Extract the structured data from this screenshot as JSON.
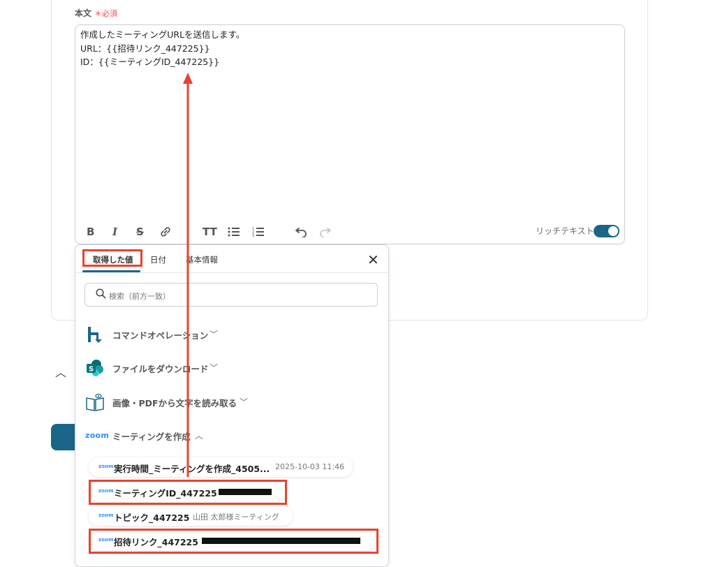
{
  "field": {
    "label": "本文",
    "required_mark": "＊必須"
  },
  "editor": {
    "lines": [
      "作成したミーティングURLを送信します。",
      "URL：{{招待リンク_447225}}",
      "ID：{{ミーティングID_447225}}"
    ]
  },
  "toolbar": {
    "rich_text_label": "リッチテキスト",
    "rich_text_enabled": true
  },
  "popup": {
    "tabs": [
      "取得した値",
      "日付",
      "基本情報"
    ],
    "active_tab": "取得した値",
    "search_placeholder": "検索（前方一致）",
    "sections": [
      {
        "label": "コマンドオペレーション",
        "icon": "command-operation-icon",
        "expanded": false
      },
      {
        "label": "ファイルをダウンロード",
        "icon": "sharepoint-icon",
        "expanded": false
      },
      {
        "label": "画像・PDFから文字を読み取る",
        "icon": "ocr-book-icon",
        "expanded": false
      },
      {
        "label": "ミーティングを作成",
        "icon": "zoom-logo",
        "expanded": true
      }
    ],
    "items": [
      {
        "title": "実行時間_ミーティングを作成_4505...",
        "value": "2025-10-03 11:46"
      },
      {
        "title": "ミーティングID_447225",
        "value": ""
      },
      {
        "title": "トピック_447225",
        "value": "山田 太郎様ミーティング"
      },
      {
        "title": "招待リンク_447225",
        "value": ""
      }
    ]
  },
  "colors": {
    "accent": "#1a6688",
    "highlight": "#e8432e",
    "zoom": "#2d8cff"
  }
}
